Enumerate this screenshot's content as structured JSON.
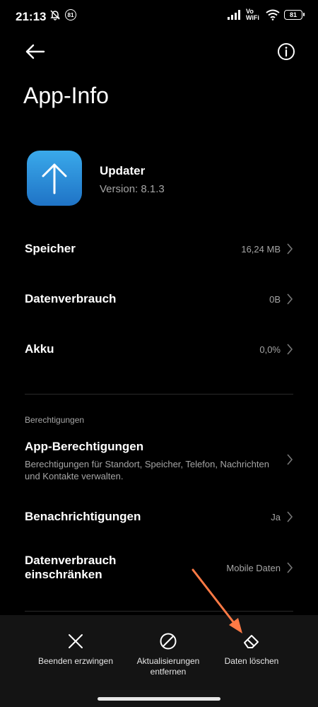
{
  "status_bar": {
    "time": "21:13",
    "notif_badge": "81",
    "volte_top": "Vo",
    "volte_bottom": "WiFi",
    "battery": "81"
  },
  "header": {
    "title": "App-Info"
  },
  "app": {
    "name": "Updater",
    "version": "Version: 8.1.3",
    "icon": "arrow-up-icon",
    "icon_colors": [
      "#3aa9ea",
      "#1f73c6"
    ]
  },
  "rows": {
    "storage": {
      "label": "Speicher",
      "value": "16,24 MB"
    },
    "data_usage": {
      "label": "Datenverbrauch",
      "value": "0B"
    },
    "battery": {
      "label": "Akku",
      "value": "0,0%"
    }
  },
  "permissions_section": {
    "heading": "Berechtigungen",
    "app_permissions": {
      "label": "App-Berechtigungen",
      "description": "Berechtigungen für Standort, Speicher, Telefon, Nachrichten und Kontakte verwalten."
    },
    "notifications": {
      "label": "Benachrichtigungen",
      "value": "Ja"
    },
    "restrict_data": {
      "label_line1": "Datenverbrauch",
      "label_line2": "einschränken",
      "value": "Mobile Daten"
    }
  },
  "bottom_actions": {
    "force_stop": "Beenden erzwingen",
    "uninstall_updates_line1": "Aktualisierungen",
    "uninstall_updates_line2": "entfernen",
    "clear_data": "Daten löschen"
  },
  "colors": {
    "background": "#000000",
    "secondary_text": "#a5a5a5",
    "bottom_bar": "#141414",
    "annotation_arrow": "#ff7a45"
  }
}
